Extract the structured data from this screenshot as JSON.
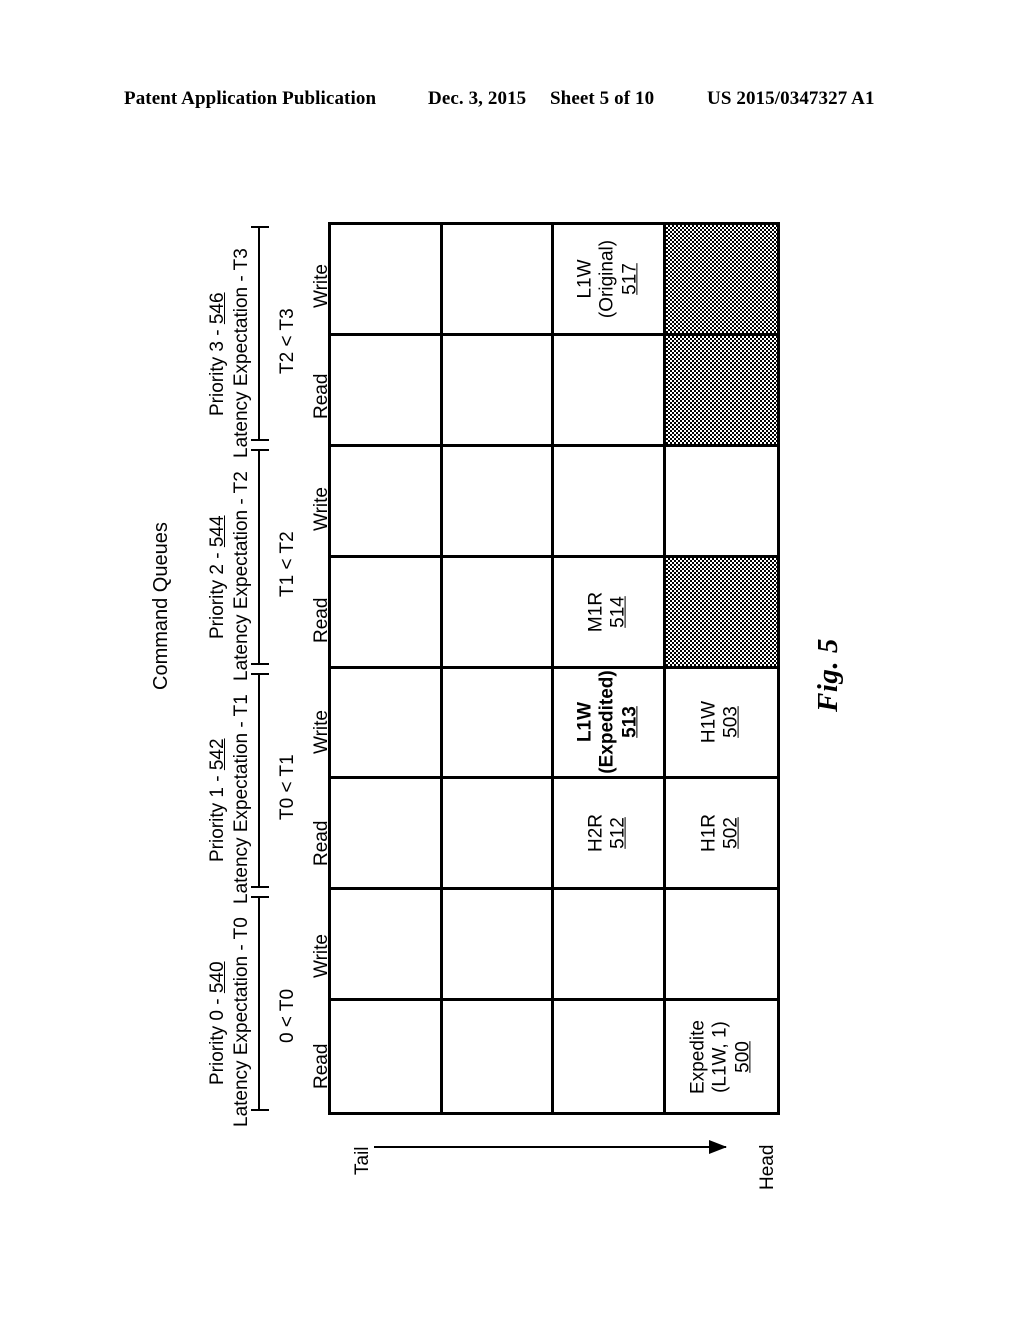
{
  "page_header": {
    "publication": "Patent Application Publication",
    "date": "Dec. 3, 2015",
    "sheet": "Sheet 5 of 10",
    "publication_number": "US 2015/0347327 A1"
  },
  "figure": {
    "caption": "Fig. 5",
    "overall_label": "Command Queues",
    "direction": {
      "tail_label": "Tail",
      "head_label": "Head"
    },
    "priority_groups": [
      {
        "title": "Priority 3 - ",
        "ref": "546",
        "latency_label": "Latency Expectation - T3",
        "range": "T2 < T3",
        "rows": [
          "Write",
          "Read"
        ]
      },
      {
        "title": "Priority 2 - ",
        "ref": "544",
        "latency_label": "Latency Expectation - T2",
        "range": "T1 < T2",
        "rows": [
          "Write",
          "Read"
        ]
      },
      {
        "title": "Priority 1 - ",
        "ref": "542",
        "latency_label": "Latency Expectation - T1",
        "range": "T0 < T1",
        "rows": [
          "Write",
          "Read"
        ]
      },
      {
        "title": "Priority 0 - ",
        "ref": "540",
        "latency_label": "Latency Expectation - T0",
        "range": "0 < T0",
        "rows": [
          "Write",
          "Read"
        ]
      }
    ],
    "row_labels": [
      "Write",
      "Read",
      "Write",
      "Read",
      "Write",
      "Read",
      "Write",
      "Read"
    ],
    "grid": {
      "columns": 4,
      "rows": 8,
      "cells": [
        [
          {
            "lines": [],
            "ref": "",
            "shaded": false,
            "bold": false
          },
          {
            "lines": [],
            "ref": "",
            "shaded": false,
            "bold": false
          },
          {
            "lines": [
              "L1W",
              "(Original)"
            ],
            "ref": "517",
            "shaded": false,
            "bold": false
          },
          {
            "lines": [],
            "ref": "",
            "shaded": true,
            "bold": false
          }
        ],
        [
          {
            "lines": [],
            "ref": "",
            "shaded": false,
            "bold": false
          },
          {
            "lines": [],
            "ref": "",
            "shaded": false,
            "bold": false
          },
          {
            "lines": [],
            "ref": "",
            "shaded": false,
            "bold": false
          },
          {
            "lines": [],
            "ref": "",
            "shaded": true,
            "bold": false
          }
        ],
        [
          {
            "lines": [],
            "ref": "",
            "shaded": false,
            "bold": false
          },
          {
            "lines": [],
            "ref": "",
            "shaded": false,
            "bold": false
          },
          {
            "lines": [],
            "ref": "",
            "shaded": false,
            "bold": false
          },
          {
            "lines": [],
            "ref": "",
            "shaded": false,
            "bold": false
          }
        ],
        [
          {
            "lines": [],
            "ref": "",
            "shaded": false,
            "bold": false
          },
          {
            "lines": [],
            "ref": "",
            "shaded": false,
            "bold": false
          },
          {
            "lines": [
              "M1R"
            ],
            "ref": "514",
            "shaded": false,
            "bold": false
          },
          {
            "lines": [],
            "ref": "",
            "shaded": true,
            "bold": false
          }
        ],
        [
          {
            "lines": [],
            "ref": "",
            "shaded": false,
            "bold": false
          },
          {
            "lines": [],
            "ref": "",
            "shaded": false,
            "bold": false
          },
          {
            "lines": [
              "L1W",
              "(Expedited)"
            ],
            "ref": "513",
            "shaded": false,
            "bold": true
          },
          {
            "lines": [
              "H1W"
            ],
            "ref": "503",
            "shaded": false,
            "bold": false
          }
        ],
        [
          {
            "lines": [],
            "ref": "",
            "shaded": false,
            "bold": false
          },
          {
            "lines": [],
            "ref": "",
            "shaded": false,
            "bold": false
          },
          {
            "lines": [
              "H2R"
            ],
            "ref": "512",
            "shaded": false,
            "bold": false
          },
          {
            "lines": [
              "H1R"
            ],
            "ref": "502",
            "shaded": false,
            "bold": false
          }
        ],
        [
          {
            "lines": [],
            "ref": "",
            "shaded": false,
            "bold": false
          },
          {
            "lines": [],
            "ref": "",
            "shaded": false,
            "bold": false
          },
          {
            "lines": [],
            "ref": "",
            "shaded": false,
            "bold": false
          },
          {
            "lines": [],
            "ref": "",
            "shaded": false,
            "bold": false
          }
        ],
        [
          {
            "lines": [],
            "ref": "",
            "shaded": false,
            "bold": false
          },
          {
            "lines": [],
            "ref": "",
            "shaded": false,
            "bold": false
          },
          {
            "lines": [],
            "ref": "",
            "shaded": false,
            "bold": false
          },
          {
            "lines": [
              "Expedite",
              "(L1W, 1)"
            ],
            "ref": "500",
            "shaded": false,
            "bold": false
          }
        ]
      ]
    }
  }
}
